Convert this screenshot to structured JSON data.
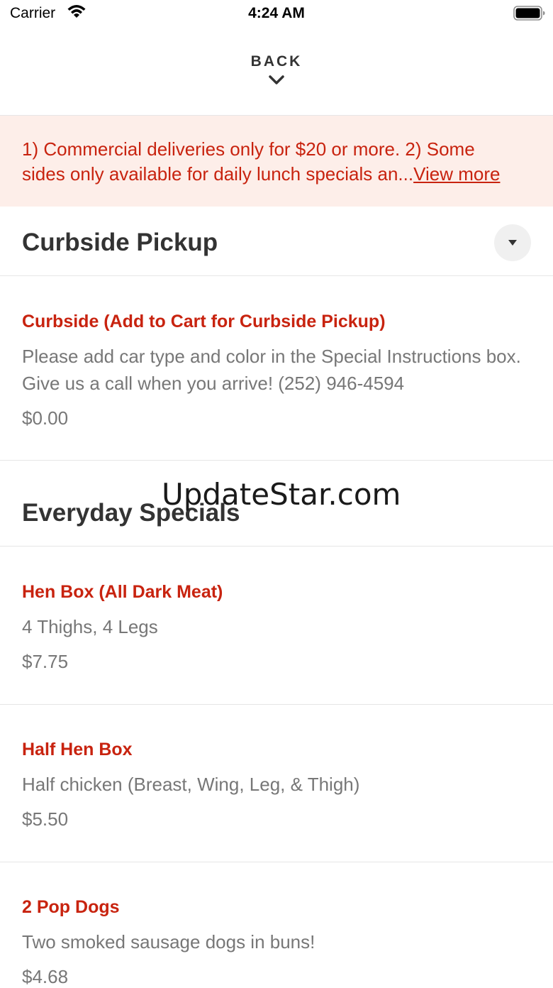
{
  "status_bar": {
    "carrier": "Carrier",
    "time": "4:24 AM"
  },
  "nav": {
    "back_label": "BACK"
  },
  "notice": {
    "line1": "1) Commercial deliveries only for $20 or more. 2) Some",
    "line2": "sides only available for daily lunch specials an...",
    "view_more": "View more"
  },
  "sections": [
    {
      "title": "Curbside Pickup",
      "items": [
        {
          "name": "Curbside (Add to Cart for Curbside Pickup)",
          "description": "Please add car type and color in the Special Instructions box. Give us a call when you arrive! (252) 946-4594",
          "price": "$0.00"
        }
      ]
    },
    {
      "title": "Everyday Specials",
      "items": [
        {
          "name": "Hen Box (All Dark Meat)",
          "description": "4 Thighs, 4 Legs",
          "price": "$7.75"
        },
        {
          "name": "Half Hen Box",
          "description": "Half chicken (Breast, Wing, Leg, & Thigh)",
          "price": "$5.50"
        },
        {
          "name": "2 Pop Dogs",
          "description": "Two smoked sausage dogs in buns!",
          "price": "$4.68"
        }
      ]
    }
  ],
  "watermark": "UpdateStar.com",
  "colors": {
    "accent": "#c8230f",
    "notice_bg": "#fdeee9",
    "text_dark": "#333333",
    "text_muted": "#777777"
  },
  "icons": {
    "wifi": "wifi-icon",
    "battery": "battery-icon",
    "back": "chevron-down-icon",
    "collapse": "caret-down-icon"
  }
}
